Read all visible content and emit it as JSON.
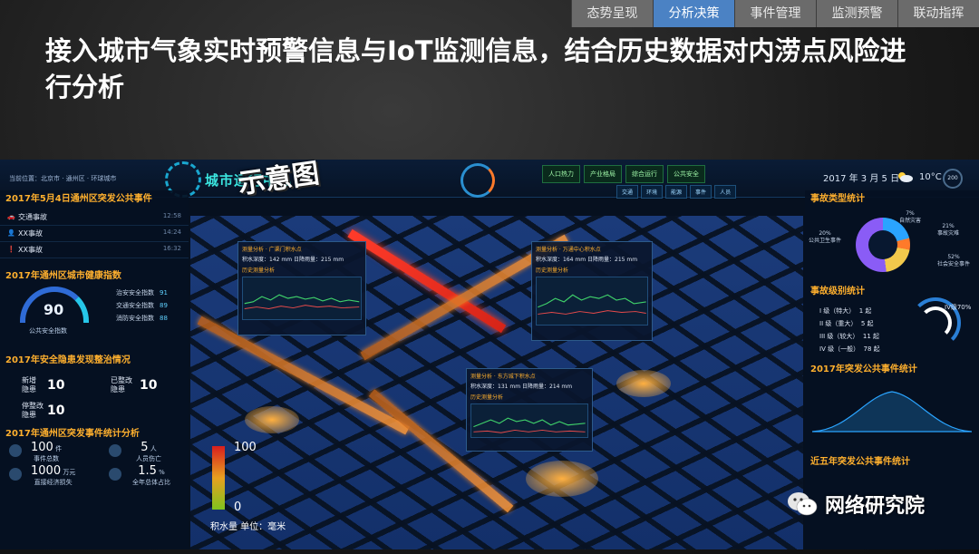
{
  "topnav": [
    "态势呈现",
    "分析决策",
    "事件管理",
    "监测预警",
    "联动指挥"
  ],
  "active_tab_index": 1,
  "headline": "接入城市气象实时预警信息与IoT监测信息，结合历史数据对内涝点风险进行分析",
  "dashboard": {
    "breadcrumb": "当前位置：北京市 · 通州区 · 环球城市",
    "hub_title": "城市运行中心",
    "watermark": "示意图",
    "controls": [
      "人口热力",
      "产业格局",
      "综合运行",
      "公共安全"
    ],
    "controls2": [
      "交通",
      "环境",
      "能源",
      "事件",
      "人员"
    ],
    "date": "2017 年 3 月 5 日",
    "temp": "10°C",
    "aqi": "200"
  },
  "left": {
    "events_title": "2017年5月4日通州区突发公共事件",
    "events": [
      {
        "name": "交通事故",
        "time": "12:58"
      },
      {
        "name": "XX事故",
        "time": "14:24"
      },
      {
        "name": "XX事故",
        "time": "16:32"
      }
    ],
    "health_title": "2017年通州区城市健康指数",
    "health_value": "90",
    "health_label": "公共安全指数",
    "health_list": [
      {
        "k": "治安安全指数",
        "v": "91"
      },
      {
        "k": "交通安全指数",
        "v": "89"
      },
      {
        "k": "消防安全指数",
        "v": "88"
      }
    ],
    "hazard_title": "2017年安全隐患发现整治情况",
    "hz_new_label": "新增\n隐患",
    "hz_new": "10",
    "hz_fixed_label": "已整改\n隐患",
    "hz_fixed": "10",
    "hz_stop_label": "停整改\n隐患",
    "hz_stop": "10",
    "stat_title": "2017年通州区突发事件统计分析",
    "stats": [
      {
        "big": "100",
        "unit": "件",
        "label": "事件总数"
      },
      {
        "big": "5",
        "unit": "人",
        "label": "人员伤亡"
      },
      {
        "big": "1000",
        "unit": "万元",
        "label": "直接经济损失"
      },
      {
        "big": "1.5",
        "unit": "%",
        "label": "全年总体占比"
      }
    ]
  },
  "popups": [
    {
      "title": "测量分析 · 广渠门积水点",
      "depth": "142",
      "rain": "215",
      "hist": "历史测量分析"
    },
    {
      "title": "测量分析 · 万通中心积水点",
      "depth": "164",
      "rain": "215",
      "hist": "历史测量分析"
    },
    {
      "title": "测量分析 · 东方城下积水点",
      "depth": "131",
      "rain": "214",
      "hist": "历史测量分析"
    }
  ],
  "popup_labels": {
    "depth": "积水深度：",
    "unit": "mm",
    "rain": "日降雨量：",
    "unit2": "mm"
  },
  "legend": {
    "hi": "100",
    "lo": "0",
    "caption": "积水量  单位：毫米"
  },
  "right": {
    "type_title": "事故类型统计",
    "type_pcts": [
      "7%",
      "21%",
      "20%",
      "52%"
    ],
    "type_labels": [
      "自然灾害",
      "事故灾难",
      "公共卫生事件",
      "社会安全事件"
    ],
    "level_title": "事故级别统计",
    "levels": [
      {
        "k": "I 级（特大）",
        "v": "1 起"
      },
      {
        "k": "II 级（重大）",
        "v": "5 起"
      },
      {
        "k": "III 级（较大）",
        "v": "11 起"
      },
      {
        "k": "IV 级（一般）",
        "v": "78 起"
      }
    ],
    "level_pct": "IV级70%",
    "trend_title": "2017年突发公共事件统计",
    "recent_title": "近五年突发公共事件统计"
  },
  "wechat_name": "网络研究院"
}
